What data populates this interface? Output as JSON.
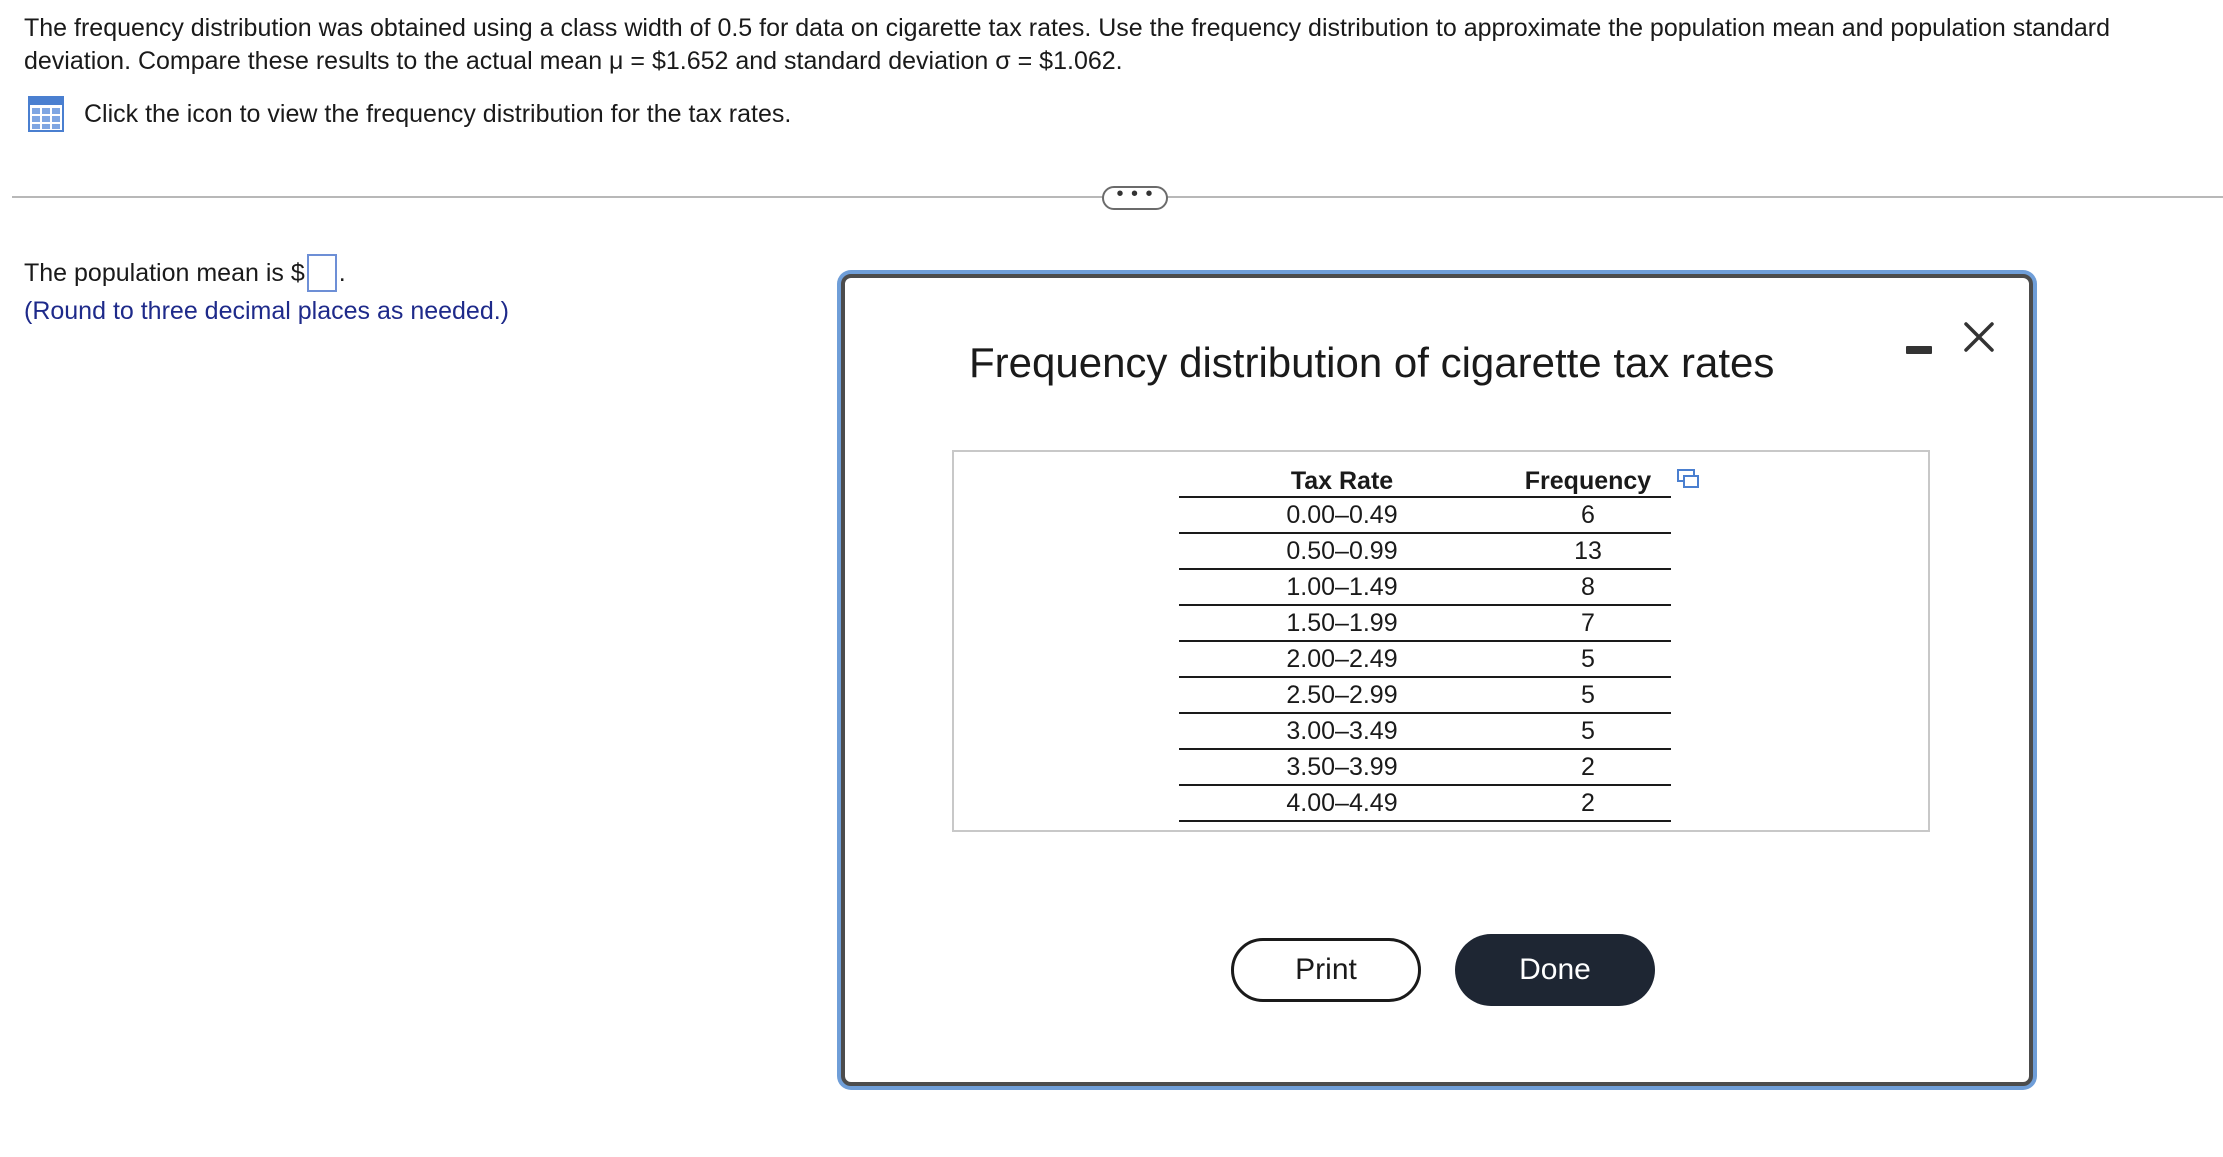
{
  "question": {
    "line1": "The frequency distribution was obtained using a class width of 0.5 for data on cigarette tax rates. Use the frequency distribution to approximate the population mean and population standard",
    "line2": "deviation. Compare these results to the actual mean μ = $1.652 and standard deviation σ = $1.062.",
    "hint": "Click the icon to view the frequency distribution for the tax rates."
  },
  "more_button": "• • •",
  "answer": {
    "prefix": "The population mean is $",
    "suffix": ".",
    "input_value": "",
    "note": "(Round to three decimal places as needed.)"
  },
  "modal": {
    "title": "Frequency distribution of cigarette tax rates",
    "table": {
      "headers": [
        "Tax Rate",
        "Frequency"
      ],
      "rows": [
        [
          "0.00–0.49",
          "6"
        ],
        [
          "0.50–0.99",
          "13"
        ],
        [
          "1.00–1.49",
          "8"
        ],
        [
          "1.50–1.99",
          "7"
        ],
        [
          "2.00–2.49",
          "5"
        ],
        [
          "2.50–2.99",
          "5"
        ],
        [
          "3.00–3.49",
          "5"
        ],
        [
          "3.50–3.99",
          "2"
        ],
        [
          "4.00–4.49",
          "2"
        ]
      ]
    },
    "print_label": "Print",
    "done_label": "Done"
  },
  "colors": {
    "accent_blue": "#6f9ed8",
    "note_blue": "#1e2a8a",
    "done_bg": "#1e2633"
  }
}
